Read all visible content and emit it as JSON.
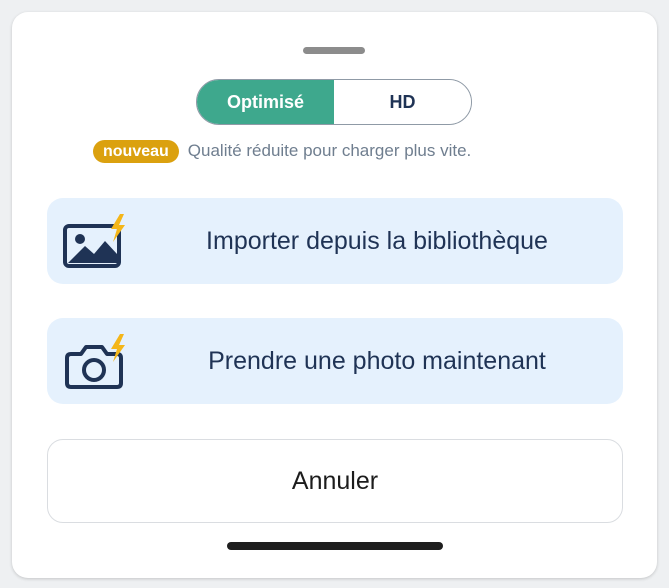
{
  "quality_toggle": {
    "options": [
      "Optimisé",
      "HD"
    ],
    "selected": "Optimisé"
  },
  "quality_note": {
    "badge": "nouveau",
    "text": "Qualité réduite pour charger plus vite."
  },
  "actions": [
    {
      "label": "Importer depuis la bibliothèque",
      "icon": "image-bolt-icon"
    },
    {
      "label": "Prendre une photo maintenant",
      "icon": "camera-bolt-icon"
    }
  ],
  "cancel_label": "Annuler",
  "colors": {
    "accent": "#3ea88d",
    "badge": "#dba10f",
    "action_bg": "#e5f1fd",
    "icon": "#1f3355",
    "bolt": "#f4b619"
  }
}
